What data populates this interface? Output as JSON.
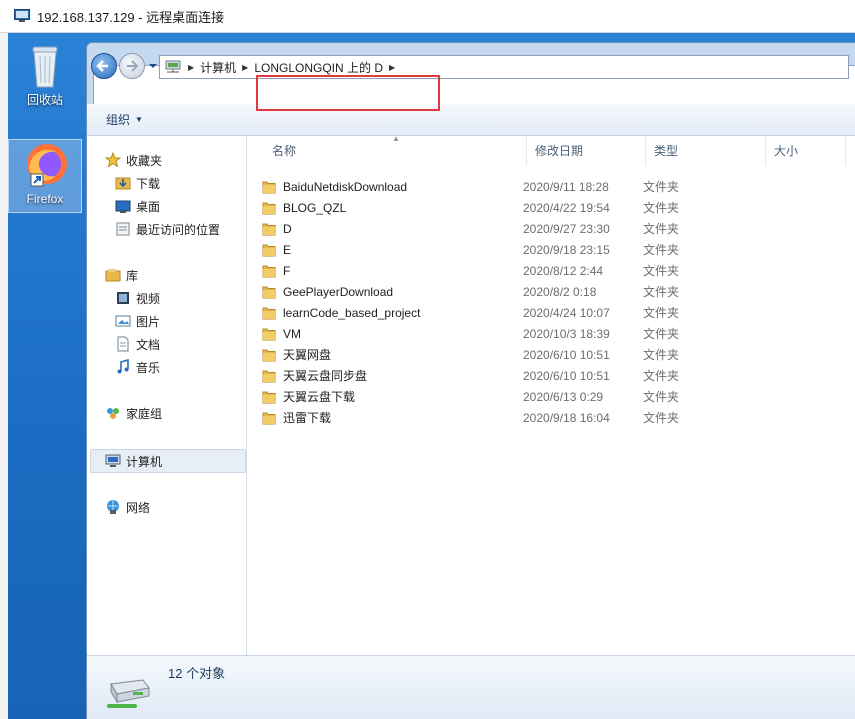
{
  "rdp": {
    "title": "192.168.137.129 - 远程桌面连接"
  },
  "desktop": {
    "icons": [
      {
        "label": "回收站",
        "icon": "recycle-bin-icon"
      },
      {
        "label": "Firefox",
        "icon": "firefox-icon"
      }
    ]
  },
  "address": {
    "crumbs": [
      "计算机",
      "LONGLONGQIN 上的 D"
    ]
  },
  "toolbar": {
    "organize_label": "组织"
  },
  "nav": {
    "favorites": "收藏夹",
    "downloads": "下载",
    "desktop": "桌面",
    "recent": "最近访问的位置",
    "libraries": "库",
    "videos": "视频",
    "pictures": "图片",
    "documents": "文档",
    "music": "音乐",
    "homegroup": "家庭组",
    "computer": "计算机",
    "network": "网络"
  },
  "columns": {
    "name": "名称",
    "date": "修改日期",
    "type": "类型",
    "size": "大小"
  },
  "files": [
    {
      "name": "BaiduNetdiskDownload",
      "date": "2020/9/11 18:28",
      "type": "文件夹"
    },
    {
      "name": "BLOG_QZL",
      "date": "2020/4/22 19:54",
      "type": "文件夹"
    },
    {
      "name": "D",
      "date": "2020/9/27 23:30",
      "type": "文件夹"
    },
    {
      "name": "E",
      "date": "2020/9/18 23:15",
      "type": "文件夹"
    },
    {
      "name": "F",
      "date": "2020/8/12 2:44",
      "type": "文件夹"
    },
    {
      "name": "GeePlayerDownload",
      "date": "2020/8/2 0:18",
      "type": "文件夹"
    },
    {
      "name": "learnCode_based_project",
      "date": "2020/4/24 10:07",
      "type": "文件夹"
    },
    {
      "name": "VM",
      "date": "2020/10/3 18:39",
      "type": "文件夹"
    },
    {
      "name": "天翼网盘",
      "date": "2020/6/10 10:51",
      "type": "文件夹"
    },
    {
      "name": "天翼云盘同步盘",
      "date": "2020/6/10 10:51",
      "type": "文件夹"
    },
    {
      "name": "天翼云盘下载",
      "date": "2020/6/13 0:29",
      "type": "文件夹"
    },
    {
      "name": "迅雷下载",
      "date": "2020/9/18 16:04",
      "type": "文件夹"
    }
  ],
  "status": {
    "text": "12 个对象"
  },
  "colors": {
    "highlight": "#e0393e",
    "folder": "#e8b84a",
    "desktop": "#1f73c8"
  }
}
